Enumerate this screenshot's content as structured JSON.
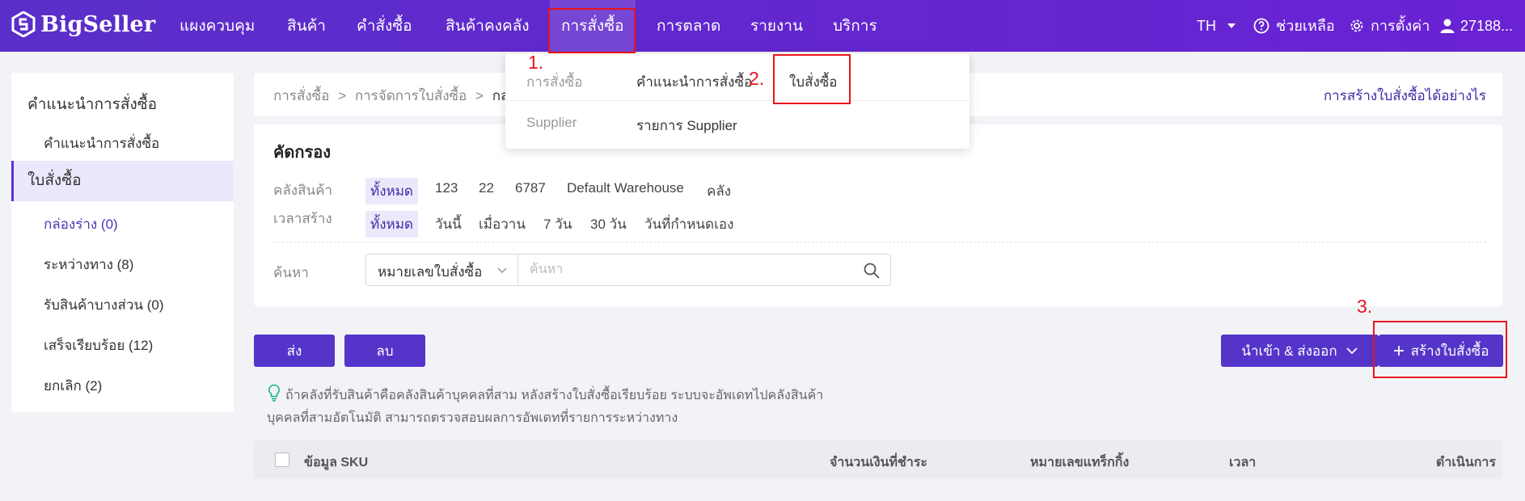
{
  "brand": {
    "name": "BigSeller"
  },
  "nav": {
    "items": [
      "แผงควบคุม",
      "สินค้า",
      "คำสั่งซื้อ",
      "สินค้าคงคลัง",
      "การสั่งซื้อ",
      "การตลาด",
      "รายงาน",
      "บริการ"
    ],
    "lang": "TH",
    "help": "ช่วยเหลือ",
    "settings": "การตั้งค่า",
    "user": "27188..."
  },
  "dropdown": {
    "row1_label": "การสั่งซื้อ",
    "row1_link1": "คำแนะนำการสั่งซื้อ",
    "row1_link2": "ใบสั่งซื้อ",
    "row2_label": "Supplier",
    "row2_link1": "รายการ Supplier"
  },
  "annotations": {
    "n1": "1.",
    "n2": "2.",
    "n3": "3."
  },
  "sidebar": {
    "group1": "คำแนะนำการสั่งซื้อ",
    "group1_item": "คำแนะนำการสั่งซื้อ",
    "group2": "ใบสั่งซื้อ",
    "items": [
      "กล่องร่าง (0)",
      "ระหว่างทาง (8)",
      "รับสินค้าบางส่วน (0)",
      "เสร็จเรียบร้อย (12)",
      "ยกเลิก (2)"
    ]
  },
  "breadcrumb": {
    "c1": "การสั่งซื้อ",
    "c2": "การจัดการใบสั่งซื้อ",
    "c3": "กล่อ",
    "sep": ">",
    "help_link": "การสร้างใบสั่งซื้อได้อย่างไร"
  },
  "filter": {
    "title": "คัดกรอง",
    "warehouse_label": "คลังสินค้า",
    "warehouse_options": [
      "ทั้งหมด",
      "123",
      "22",
      "6787",
      "Default Warehouse",
      "คลัง"
    ],
    "time_label": "เวลาสร้าง",
    "time_options": [
      "ทั้งหมด",
      "วันนี้",
      "เมื่อวาน",
      "7 วัน",
      "30 วัน",
      "วันที่กำหนดเอง"
    ],
    "search_label": "ค้นหา",
    "search_type": "หมายเลขใบสั่งซื้อ",
    "search_placeholder": "ค้นหา"
  },
  "actions": {
    "send": "ส่ง",
    "delete": "ลบ",
    "import_export": "นำเข้า & ส่งออก",
    "create": "สร้างใบสั่งซื้อ"
  },
  "tip": {
    "line1": "ถ้าคลังที่รับสินค้าคือคลังสินค้าบุคคลที่สาม หลังสร้างใบสั่งซื้อเรียบร้อย ระบบจะอัพเดทไปคลังสินค้า",
    "line2": "บุคคลที่สามอัตโนมัติ สามารถตรวจสอบผลการอัพเดทที่รายการระหว่างทาง"
  },
  "table": {
    "headers": [
      "ข้อมูล SKU",
      "จำนวนเงินที่ชำระ",
      "หมายเลขแทร็กกิ้ง",
      "เวลา",
      "ดำเนินการ"
    ]
  },
  "colors": {
    "nav_bg": "#5a2fc9",
    "primary": "#5434c9",
    "annotation": "#e8141c"
  }
}
